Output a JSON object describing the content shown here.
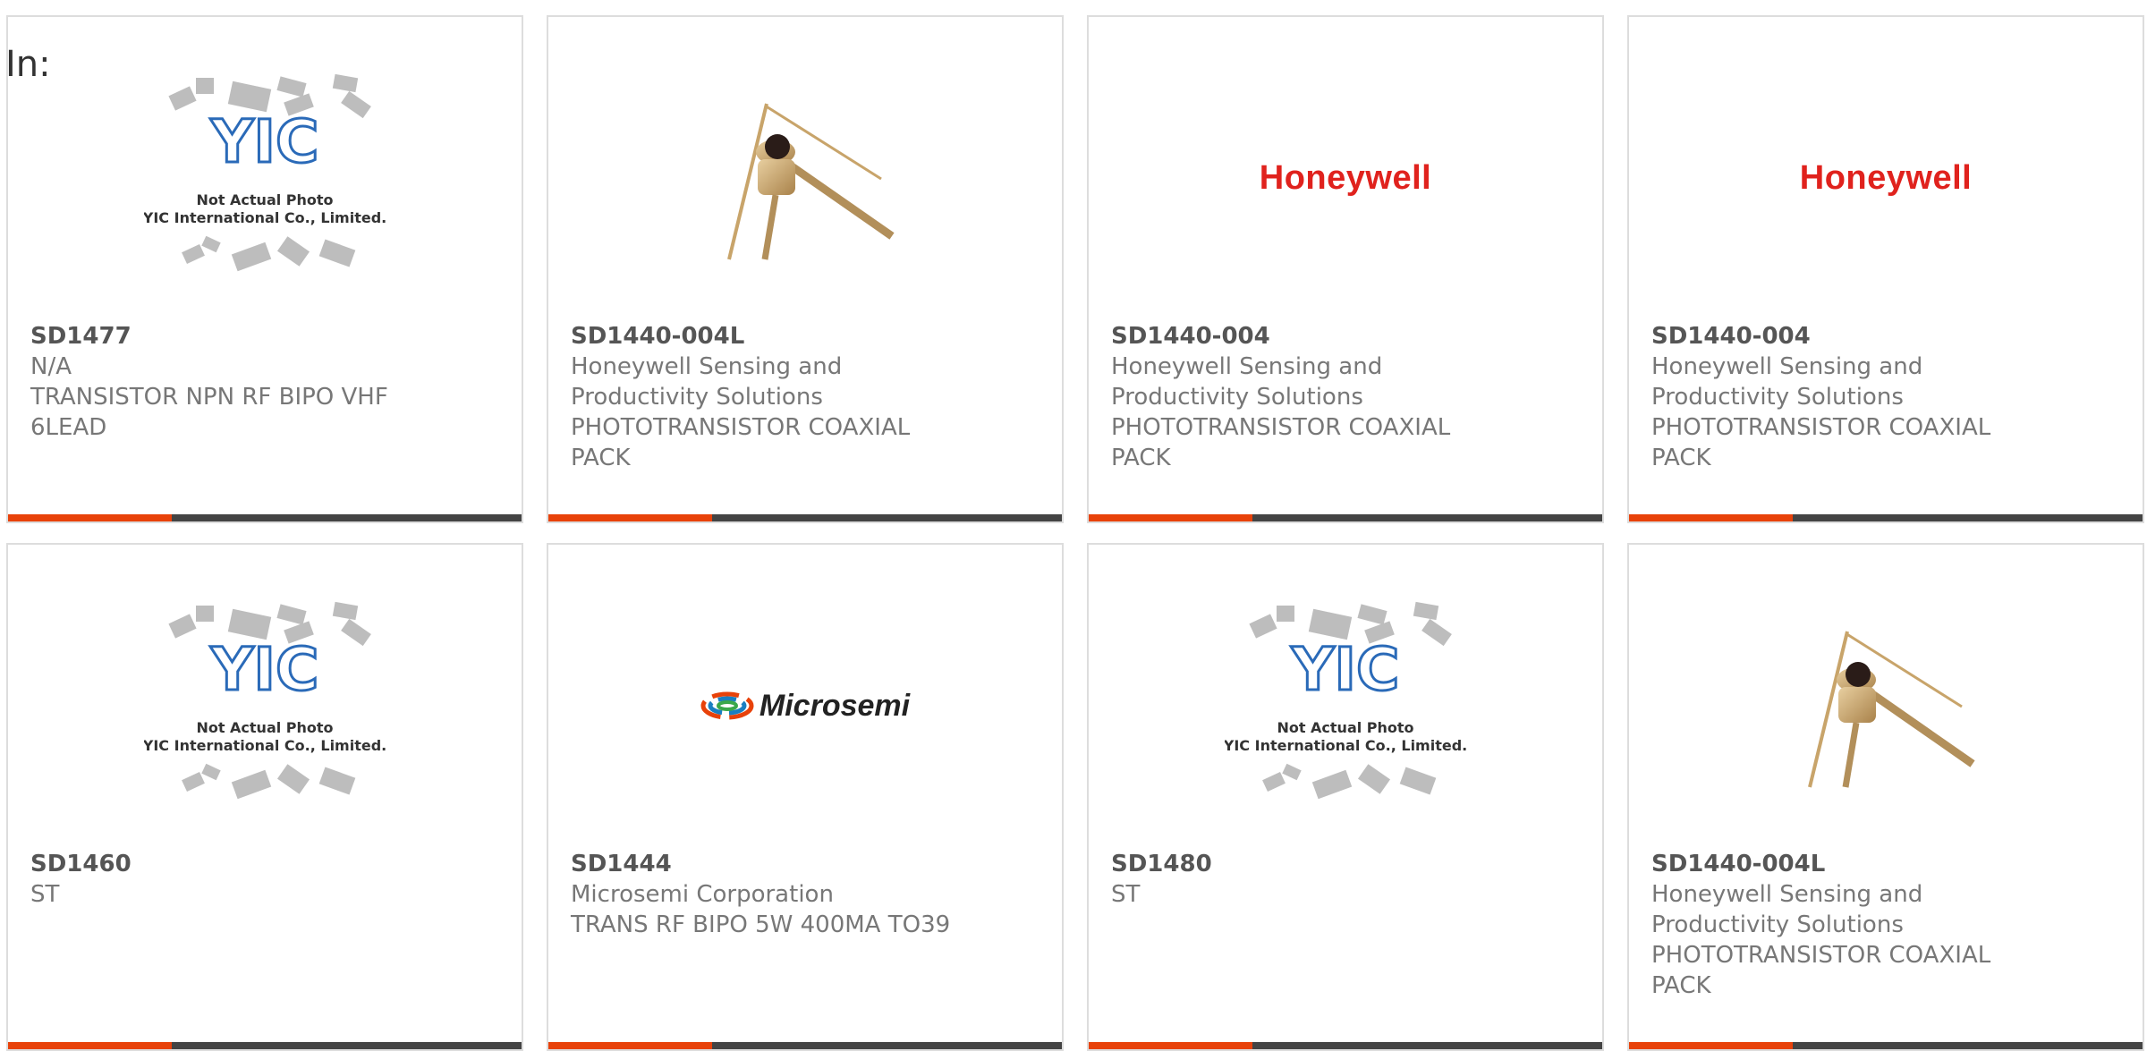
{
  "page": {
    "in_label": "In:"
  },
  "placeholder": {
    "caption_line1": "Not Actual Photo",
    "caption_line2": "YIC International Co., Limited.",
    "logo_text": "YIC"
  },
  "logos": {
    "honeywell": "Honeywell",
    "microsemi": "Microsemi"
  },
  "colors": {
    "accent": "#e8420a",
    "bar": "#444444",
    "honeywell_red": "#e0221d",
    "border": "#dddddd"
  },
  "cards": [
    {
      "part_number": "SD1477",
      "manufacturer": "N/A",
      "description": "TRANSISTOR NPN RF BIPO VHF 6LEAD",
      "image": "yic-placeholder"
    },
    {
      "part_number": "SD1440-004L",
      "manufacturer": "Honeywell Sensing and Productivity Solutions",
      "description": "PHOTOTRANSISTOR COAXIAL PACK",
      "image": "phototransistor-photo"
    },
    {
      "part_number": "SD1440-004",
      "manufacturer": "Honeywell Sensing and Productivity Solutions",
      "description": "PHOTOTRANSISTOR COAXIAL PACK",
      "image": "honeywell-logo"
    },
    {
      "part_number": "SD1440-004",
      "manufacturer": "Honeywell Sensing and Productivity Solutions",
      "description": "PHOTOTRANSISTOR COAXIAL PACK",
      "image": "honeywell-logo"
    },
    {
      "part_number": "SD1460",
      "manufacturer": "ST",
      "description": "",
      "image": "yic-placeholder"
    },
    {
      "part_number": "SD1444",
      "manufacturer": "Microsemi Corporation",
      "description": "TRANS RF BIPO 5W 400MA TO39",
      "image": "microsemi-logo"
    },
    {
      "part_number": "SD1480",
      "manufacturer": "ST",
      "description": "",
      "image": "yic-placeholder"
    },
    {
      "part_number": "SD1440-004L",
      "manufacturer": "Honeywell Sensing and Productivity Solutions",
      "description": "PHOTOTRANSISTOR COAXIAL PACK",
      "image": "phototransistor-photo"
    }
  ]
}
